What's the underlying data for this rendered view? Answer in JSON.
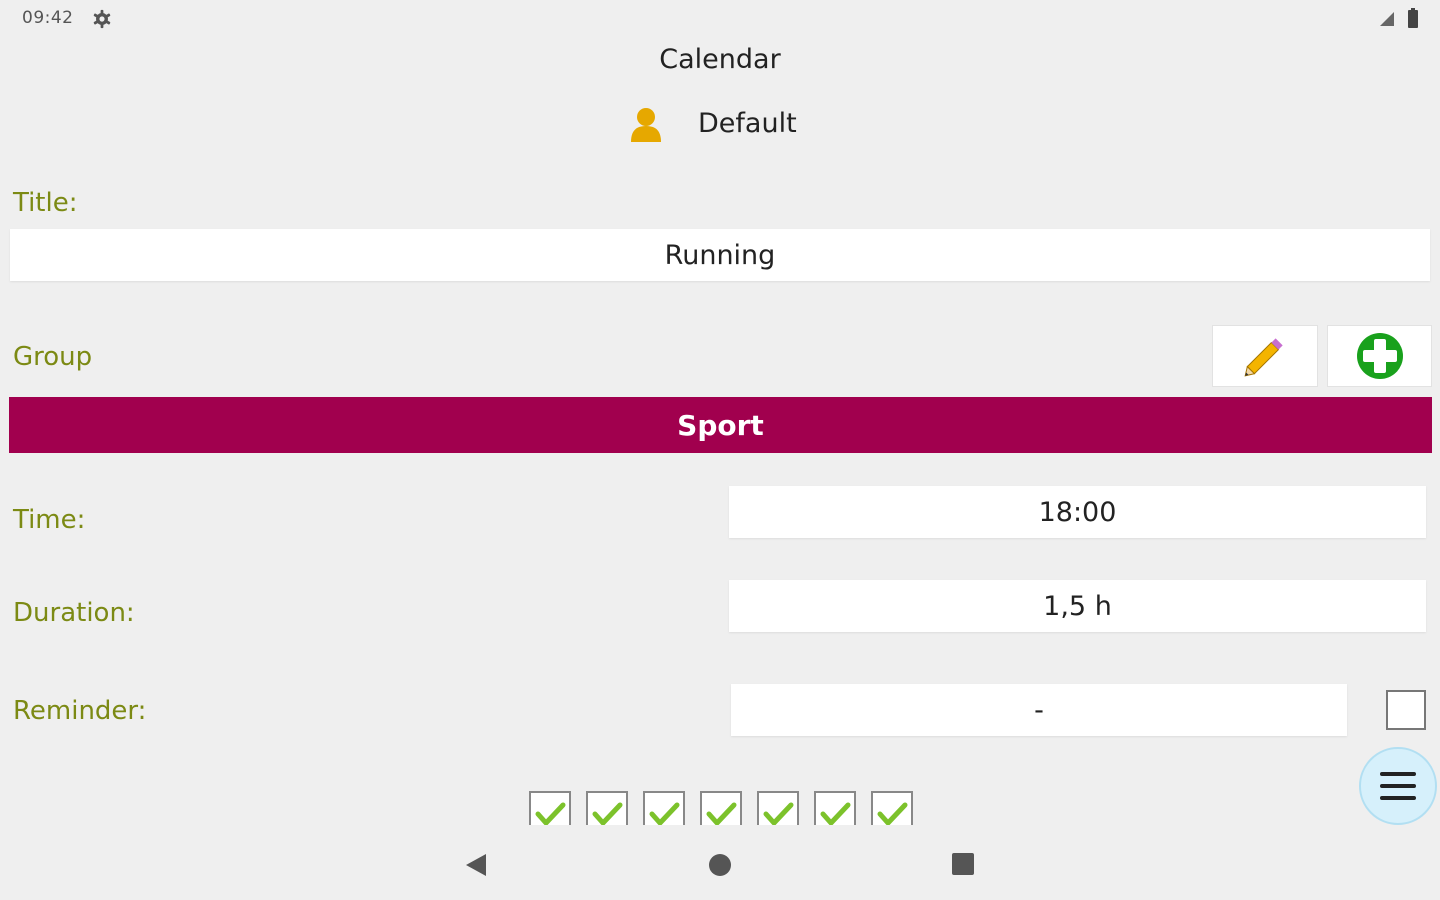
{
  "status_bar": {
    "time": "09:42",
    "settings_icon": "gear-icon",
    "signal_icon": "signal-icon",
    "battery_icon": "battery-icon"
  },
  "header": {
    "title": "Calendar",
    "profile_icon": "person-icon",
    "profile_name": "Default"
  },
  "form": {
    "title_label": "Title:",
    "title_value": "Running",
    "group_label": "Group",
    "group_value": "Sport",
    "group_color": "#a1004e",
    "edit_group_icon": "pencil-icon",
    "add_group_icon": "plus-circle-icon",
    "time_label": "Time:",
    "time_value": "18:00",
    "duration_label": "Duration:",
    "duration_value": "1,5 h",
    "reminder_label": "Reminder:",
    "reminder_value": "-",
    "reminder_checked": false,
    "label_color": "#7c8a14"
  },
  "weekdays": {
    "checked": [
      true,
      true,
      true,
      true,
      true,
      true,
      true
    ]
  },
  "fab_icon": "menu-icon",
  "navigation": {
    "back_icon": "back-triangle-icon",
    "home_icon": "home-circle-icon",
    "recents_icon": "recents-square-icon"
  }
}
